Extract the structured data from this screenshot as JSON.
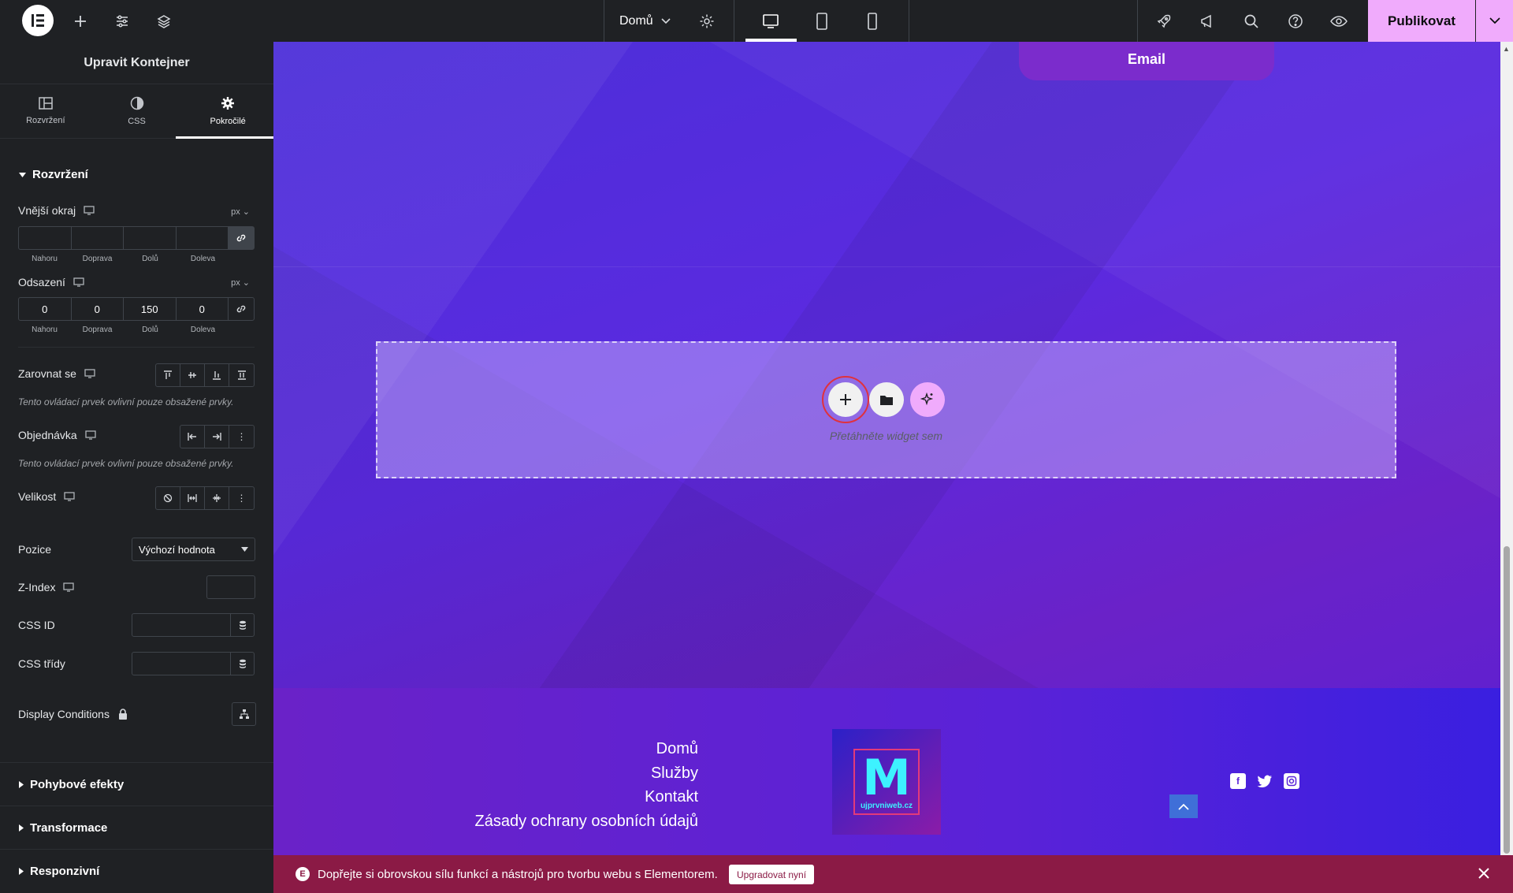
{
  "topbar": {
    "page_name": "Domů",
    "publish_label": "Publikovat"
  },
  "panel": {
    "title": "Upravit Kontejner",
    "tabs": [
      {
        "label": "Rozvržení",
        "icon": "layout-icon"
      },
      {
        "label": "CSS",
        "icon": "contrast-icon"
      },
      {
        "label": "Pokročilé",
        "icon": "gear-icon",
        "active": true
      }
    ],
    "section_title": "Rozvržení",
    "margin": {
      "label": "Vnější okraj",
      "unit": "px",
      "values": [
        "",
        "",
        "",
        ""
      ],
      "sides": [
        "Nahoru",
        "Doprava",
        "Dolů",
        "Doleva"
      ]
    },
    "padding": {
      "label": "Odsazení",
      "unit": "px",
      "values": [
        "0",
        "0",
        "150",
        "0"
      ],
      "sides": [
        "Nahoru",
        "Doprava",
        "Dolů",
        "Doleva"
      ]
    },
    "align_self": {
      "label": "Zarovnat se",
      "note": "Tento ovládací prvek ovlivní pouze obsažené prvky."
    },
    "order": {
      "label": "Objednávka",
      "note": "Tento ovládací prvek ovlivní pouze obsažené prvky."
    },
    "size": {
      "label": "Velikost"
    },
    "position": {
      "label": "Pozice",
      "value": "Výchozí hodnota"
    },
    "zindex": {
      "label": "Z-Index"
    },
    "css_id": {
      "label": "CSS ID"
    },
    "css_classes": {
      "label": "CSS třídy"
    },
    "display_conditions": {
      "label": "Display Conditions"
    },
    "accordions": [
      "Pohybové efekty",
      "Transformace",
      "Responzivní"
    ]
  },
  "canvas": {
    "email_button": "Email",
    "dropzone_text": "Přetáhněte widget sem",
    "footer_links": [
      "Domů",
      "Služby",
      "Kontakt",
      "Zásady ochrany osobních údajů"
    ],
    "logo_letter": "M",
    "logo_text": "ujprvniweb.cz"
  },
  "promo": {
    "text": "Dopřejte si obrovskou sílu funkcí a nástrojů pro tvorbu webu s Elementorem.",
    "button": "Upgradovat nyní"
  },
  "colors": {
    "accent_pink": "#f0abfc",
    "panel_bg": "#1f2124",
    "promo_bg": "#8b1a45",
    "highlight_red": "#e0313d"
  }
}
